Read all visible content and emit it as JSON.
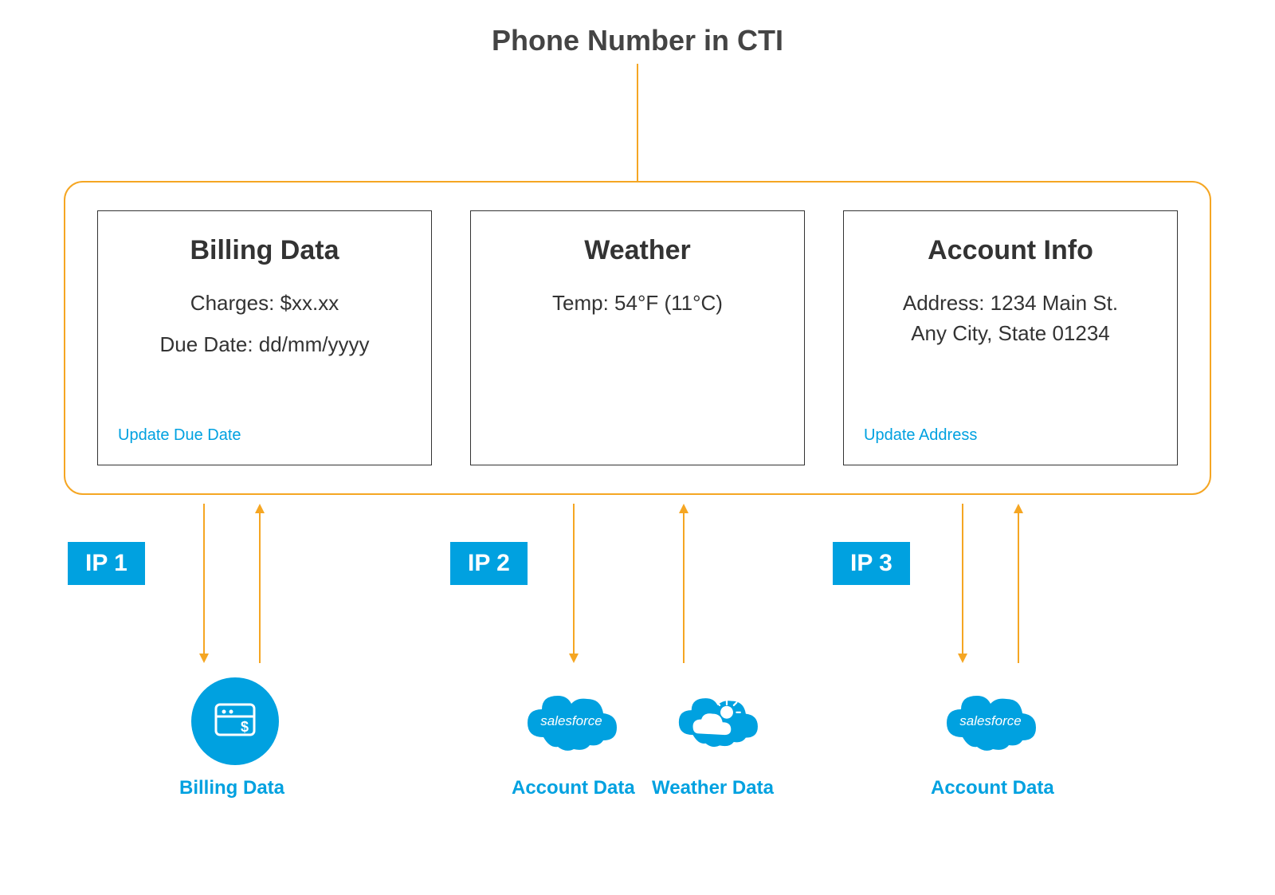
{
  "title": "Phone Number in CTI",
  "cards": {
    "billing": {
      "title": "Billing Data",
      "charges": "Charges: $xx.xx",
      "due_date": "Due Date: dd/mm/yyyy",
      "link": "Update Due Date"
    },
    "weather": {
      "title": "Weather",
      "temp": "Temp: 54°F (11°C)"
    },
    "account": {
      "title": "Account Info",
      "address1": "Address: 1234 Main St.",
      "address2": "Any City, State 01234",
      "link": "Update Address"
    }
  },
  "ips": {
    "ip1": "IP 1",
    "ip2": "IP 2",
    "ip3": "IP 3"
  },
  "sources": {
    "billing": "Billing Data",
    "account": "Account Data",
    "weather": "Weather Data",
    "account2": "Account Data"
  },
  "icons": {
    "salesforce": "salesforce"
  }
}
